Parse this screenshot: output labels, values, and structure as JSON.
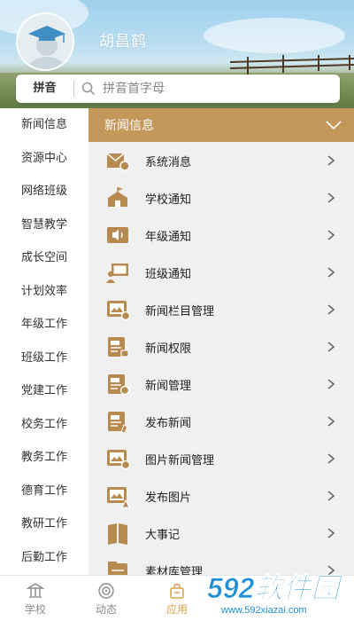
{
  "header": {
    "username": "胡昌鹤"
  },
  "search": {
    "mode_label": "拼音",
    "placeholder": "拼音首字母"
  },
  "sidebar": {
    "items": [
      {
        "label": "新闻信息"
      },
      {
        "label": "资源中心"
      },
      {
        "label": "网络班级"
      },
      {
        "label": "智慧教学"
      },
      {
        "label": "成长空间"
      },
      {
        "label": "计划效率"
      },
      {
        "label": "年级工作"
      },
      {
        "label": "班级工作"
      },
      {
        "label": "党建工作"
      },
      {
        "label": "校务工作"
      },
      {
        "label": "教务工作"
      },
      {
        "label": "德育工作"
      },
      {
        "label": "教研工作"
      },
      {
        "label": "后勤工作"
      }
    ]
  },
  "panel": {
    "title": "新闻信息",
    "items": [
      {
        "label": "系统消息",
        "icon": "system-message-icon"
      },
      {
        "label": "学校通知",
        "icon": "school-notice-icon"
      },
      {
        "label": "年级通知",
        "icon": "grade-notice-icon"
      },
      {
        "label": "班级通知",
        "icon": "class-notice-icon"
      },
      {
        "label": "新闻栏目管理",
        "icon": "news-column-icon"
      },
      {
        "label": "新闻权限",
        "icon": "news-permission-icon"
      },
      {
        "label": "新闻管理",
        "icon": "news-management-icon"
      },
      {
        "label": "发布新闻",
        "icon": "publish-news-icon"
      },
      {
        "label": "图片新闻管理",
        "icon": "image-news-icon"
      },
      {
        "label": "发布图片",
        "icon": "publish-image-icon"
      },
      {
        "label": "大事记",
        "icon": "chronicle-icon"
      },
      {
        "label": "素材库管理",
        "icon": "material-library-icon"
      }
    ]
  },
  "tabbar": {
    "tabs": [
      {
        "label": "学校",
        "icon": "school-icon",
        "active": false
      },
      {
        "label": "动态",
        "icon": "feed-icon",
        "active": false
      },
      {
        "label": "应用",
        "icon": "apps-icon",
        "active": true
      }
    ]
  },
  "watermark": {
    "brand": "592软件园",
    "url": "www.592xiazai.com"
  },
  "colors": {
    "accent": "#c4975a",
    "accent_active": "#d8a24a",
    "watermark": "#1f8fd6",
    "panel_bg": "#f0f0f0"
  }
}
